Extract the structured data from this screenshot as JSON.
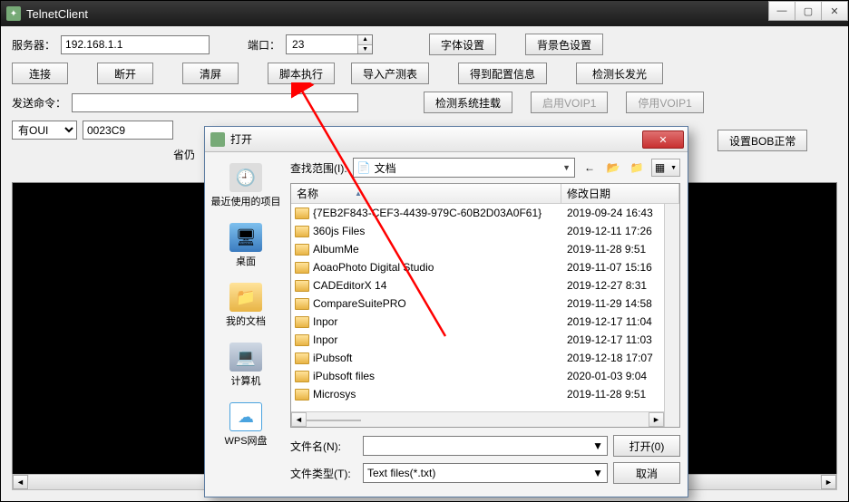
{
  "app": {
    "title": "TelnetClient"
  },
  "labels": {
    "server": "服务器：",
    "port": "端口：",
    "send_cmd": "发送命令：",
    "save_prefix": "省仍"
  },
  "inputs": {
    "server_value": "192.168.1.1",
    "port_value": "23",
    "send_value": ""
  },
  "buttons": {
    "font": "字体设置",
    "bg": "背景色设置",
    "connect": "连接",
    "disconnect": "断开",
    "clear": "清屏",
    "script": "脚本执行",
    "import": "导入产测表",
    "getcfg": "得到配置信息",
    "detect_long": "检测长发光",
    "detect_sys": "检测系统挂载",
    "enable_voip": "启用VOIP1",
    "disable_voip": "停用VOIP1",
    "set_bob": "设置BOB正常"
  },
  "combos": {
    "oui_label": "有OUI",
    "oui_value": "0023C9"
  },
  "dialog": {
    "title": "打开",
    "lookin_label": "查找范围(I):",
    "lookin_value": "文档",
    "filename_label": "文件名(N):",
    "filename_value": "",
    "filetype_label": "文件类型(T):",
    "filetype_value": "Text files(*.txt)",
    "open_btn": "打开(0)",
    "cancel_btn": "取消",
    "col_name": "名称",
    "col_date": "修改日期",
    "places": {
      "recent": "最近使用的项目",
      "desktop": "桌面",
      "documents": "我的文档",
      "computer": "计算机",
      "wps": "WPS网盘"
    },
    "files": [
      {
        "name": "{7EB2F843-CEF3-4439-979C-60B2D03A0F61}",
        "date": "2019-09-24 16:43"
      },
      {
        "name": "360js Files",
        "date": "2019-12-11 17:26"
      },
      {
        "name": "AlbumMe",
        "date": "2019-11-28 9:51"
      },
      {
        "name": "AoaoPhoto Digital Studio",
        "date": "2019-11-07 15:16"
      },
      {
        "name": "CADEditorX 14",
        "date": "2019-12-27 8:31"
      },
      {
        "name": "CompareSuitePRO",
        "date": "2019-11-29 14:58"
      },
      {
        "name": "Inpor",
        "date": "2019-12-17 11:04"
      },
      {
        "name": "Inpor",
        "date": "2019-12-17 11:03"
      },
      {
        "name": "iPubsoft",
        "date": "2019-12-18 17:07"
      },
      {
        "name": "iPubsoft files",
        "date": "2020-01-03 9:04"
      },
      {
        "name": "Microsys",
        "date": "2019-11-28 9:51"
      }
    ]
  }
}
